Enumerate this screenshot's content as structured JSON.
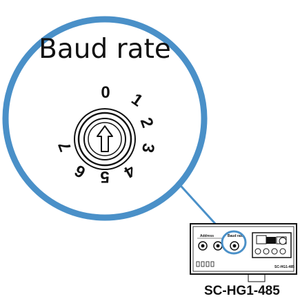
{
  "zoom": {
    "title": "Baud rate",
    "dial_numbers": [
      "0",
      "1",
      "2",
      "3",
      "4",
      "5",
      "6",
      "7"
    ]
  },
  "device": {
    "address_label": "Address",
    "baud_label": "Baud rate",
    "model_small": "SC-HG1-485"
  },
  "model_label": "SC-HG1-485",
  "colors": {
    "callout": "#4a90c8",
    "line": "#111111"
  },
  "icons": [
    "up-arrow-icon"
  ]
}
